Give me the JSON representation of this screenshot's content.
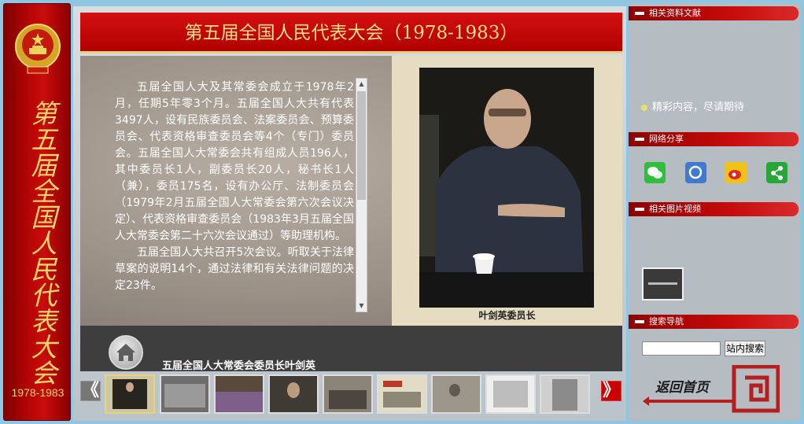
{
  "left": {
    "vertical_title": "第五届全国人民代表大会",
    "years": "1978-1983"
  },
  "main": {
    "title": "第五届全国人民代表大会（1978-1983）",
    "paragraphs": [
      "五届全国人大及其常委会成立于1978年2月，任期5年零3个月。五届全国人大共有代表3497人，设有民族委员会、法案委员会、预算委员会、代表资格审查委员会等4个（专门）委员会。五届全国人大常委会共有组成人员196人，其中委员长1人，副委员长20人，秘书长1人（兼），委员175名，设有办公厅、法制委员会（1979年2月五届全国人大常委会第六次会议决定）、代表资格审查委员会（1983年3月五届全国人大常委会第二十六次会议通过）等助理机构。",
      "五届全国人大共召开5次会议。听取关于法律草案的说明14个，通过法律和有关法律问题的决定23件。"
    ],
    "photo_caption": "叶剑英委员长",
    "caption_text": "五届全国人大常委会委员长叶剑英",
    "nav_prev": "《",
    "nav_next": "》"
  },
  "sidebar": {
    "docs_header": "相关资料文献",
    "docs_note": "精彩内容，尽请期待",
    "share_header": "网络分享",
    "share_icons": [
      "wechat-icon",
      "pengyou-icon",
      "weibo-icon",
      "share-icon"
    ],
    "media_header": "相关图片视频",
    "search_header": "搜索导航",
    "search_value": "",
    "search_button": "站内搜索",
    "back_home": "返回首页"
  },
  "colors": {
    "accent_red": "#c80000",
    "gold": "#f4d36a",
    "background": "#8fc6e4"
  }
}
